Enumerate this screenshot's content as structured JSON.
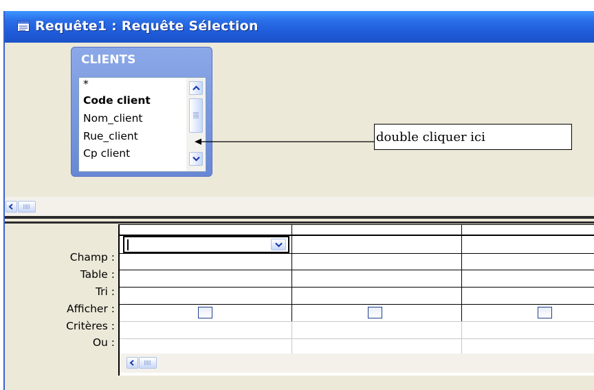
{
  "window": {
    "title": "Requête1 : Requête Sélection",
    "title_icon": "query-window-icon",
    "titlebar_color": "#1e5ad8"
  },
  "table_box": {
    "title": "CLIENTS",
    "fields": [
      "*",
      "Code client",
      "Nom_client",
      "Rue_client",
      "Cp client"
    ],
    "bold_field": "Code client"
  },
  "callout": {
    "text": "double cliquer ici"
  },
  "grid": {
    "row_labels": [
      "Champ :",
      "Table :",
      "Tri :",
      "Afficher :",
      "Critères :",
      "Ou :"
    ],
    "columns": 3
  },
  "icons": {
    "scroll_up": "chevron-up-icon",
    "scroll_down": "chevron-down-icon",
    "scroll_left": "chevron-left-icon",
    "dropdown": "chevron-down-icon"
  }
}
